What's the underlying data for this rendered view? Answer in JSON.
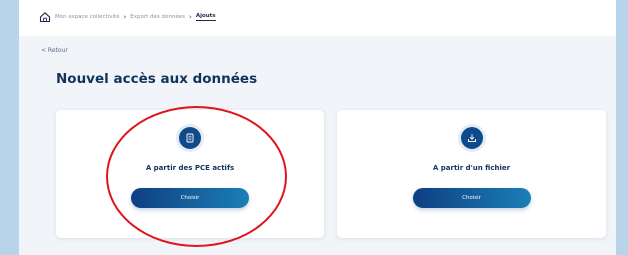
{
  "breadcrumb": {
    "items": [
      "Mon espace collectivité",
      "Export des données"
    ],
    "current": "Ajouts"
  },
  "back_link": "< Retour",
  "page_title": "Nouvel accès aux données",
  "cards": [
    {
      "label": "A partir des PCE actifs",
      "button": "Choisir",
      "icon": "document-list-icon"
    },
    {
      "label": "A partir d'un fichier",
      "button": "Choisir",
      "icon": "download-tray-icon"
    }
  ],
  "colors": {
    "accent": "#0f4a8a",
    "title": "#10345c",
    "highlight_circle": "#e0141b",
    "page_bg": "#f1f4f8",
    "outer_bg": "#b8d4ea"
  }
}
